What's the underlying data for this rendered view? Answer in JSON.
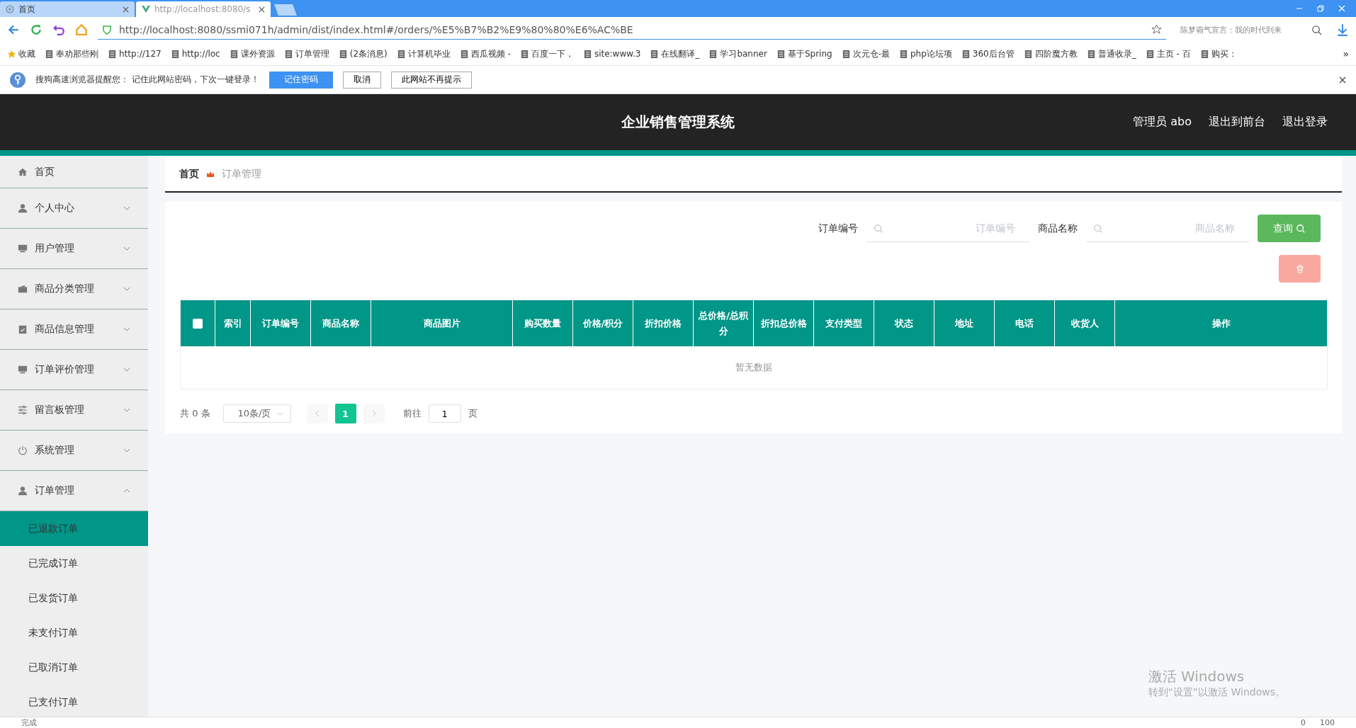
{
  "browser": {
    "tabs": [
      {
        "label": "首页",
        "selected": false
      },
      {
        "label": "http://localhost:8080/s",
        "selected": true
      }
    ],
    "url": "http://localhost:8080/ssmi071h/admin/dist/index.html#/orders/%E5%B7%B2%E9%80%80%E6%AC%BE",
    "search_placeholder": "陈梦霸气宣言：我的时代到来",
    "bookmarks": [
      "收藏",
      "奉劝那些刚",
      "http://127",
      "http://loc",
      "课外资源",
      "订单管理",
      "(2条消息)",
      "计算机毕业",
      "西瓜视频 -",
      "百度一下，",
      "site:www.3",
      "在线翻译_",
      "学习banner",
      "基于Spring",
      "次元仓-最",
      "php论坛项",
      "360后台管",
      "四阶魔方教",
      "普通收录_",
      "主页 - 百",
      "购买："
    ],
    "bookmarks_more": "»",
    "notice": {
      "text": "搜狗高速浏览器提醒您： 记住此网站密码，下次一键登录！",
      "buttons": [
        {
          "label": "记住密码",
          "primary": true
        },
        {
          "label": "取消",
          "primary": false
        },
        {
          "label": "此网站不再提示",
          "primary": false
        }
      ]
    }
  },
  "header": {
    "title": "企业销售管理系统",
    "links": [
      "管理员 abo",
      "退出到前台",
      "退出登录"
    ]
  },
  "sidebar": {
    "items": [
      {
        "label": "首页",
        "kind": "link"
      },
      {
        "label": "个人中心",
        "kind": "submenu",
        "expanded": false
      },
      {
        "label": "用户管理",
        "kind": "submenu",
        "expanded": false
      },
      {
        "label": "商品分类管理",
        "kind": "submenu",
        "expanded": false
      },
      {
        "label": "商品信息管理",
        "kind": "submenu",
        "expanded": false
      },
      {
        "label": "订单评价管理",
        "kind": "submenu",
        "expanded": false
      },
      {
        "label": "留言板管理",
        "kind": "submenu",
        "expanded": false
      },
      {
        "label": "系统管理",
        "kind": "submenu",
        "expanded": false
      },
      {
        "label": "订单管理",
        "kind": "submenu",
        "expanded": true,
        "children": [
          {
            "label": "已退款订单",
            "selected": true
          },
          {
            "label": "已完成订单",
            "selected": false
          },
          {
            "label": "已发货订单",
            "selected": false
          },
          {
            "label": "未支付订单",
            "selected": false
          },
          {
            "label": "已取消订单",
            "selected": false
          },
          {
            "label": "已支付订单",
            "selected": false
          }
        ]
      }
    ]
  },
  "breadcrumb": [
    "首页",
    "订单管理"
  ],
  "search": {
    "fields": [
      {
        "label": "订单编号",
        "placeholder": "订单编号"
      },
      {
        "label": "商品名称",
        "placeholder": "商品名称"
      }
    ],
    "button": "查询"
  },
  "delete_button": {
    "disabled": true
  },
  "table": {
    "select_all": {
      "checked": false
    },
    "columns": [
      "索引",
      "订单编号",
      "商品名称",
      "商品图片",
      "购买数量",
      "价格/积分",
      "折扣价格",
      "总价格/总积分",
      "折扣总价格",
      "支付类型",
      "状态",
      "地址",
      "电话",
      "收货人",
      "操作"
    ],
    "empty_text": "暂无数据"
  },
  "pagination": {
    "total": "共 0 条",
    "page_size": "10条/页",
    "prev_disabled": true,
    "next_disabled": true,
    "pages": [
      {
        "label": "1",
        "selected": true
      }
    ],
    "goto_label": "前往",
    "goto_value": "1",
    "goto_suffix": "页"
  },
  "status_bar": {
    "text": "完成",
    "ad_count": "0",
    "zoom": "100"
  },
  "os_notice": {
    "title": "激活 Windows",
    "text": "转到“设置”以激活 Windows。"
  }
}
